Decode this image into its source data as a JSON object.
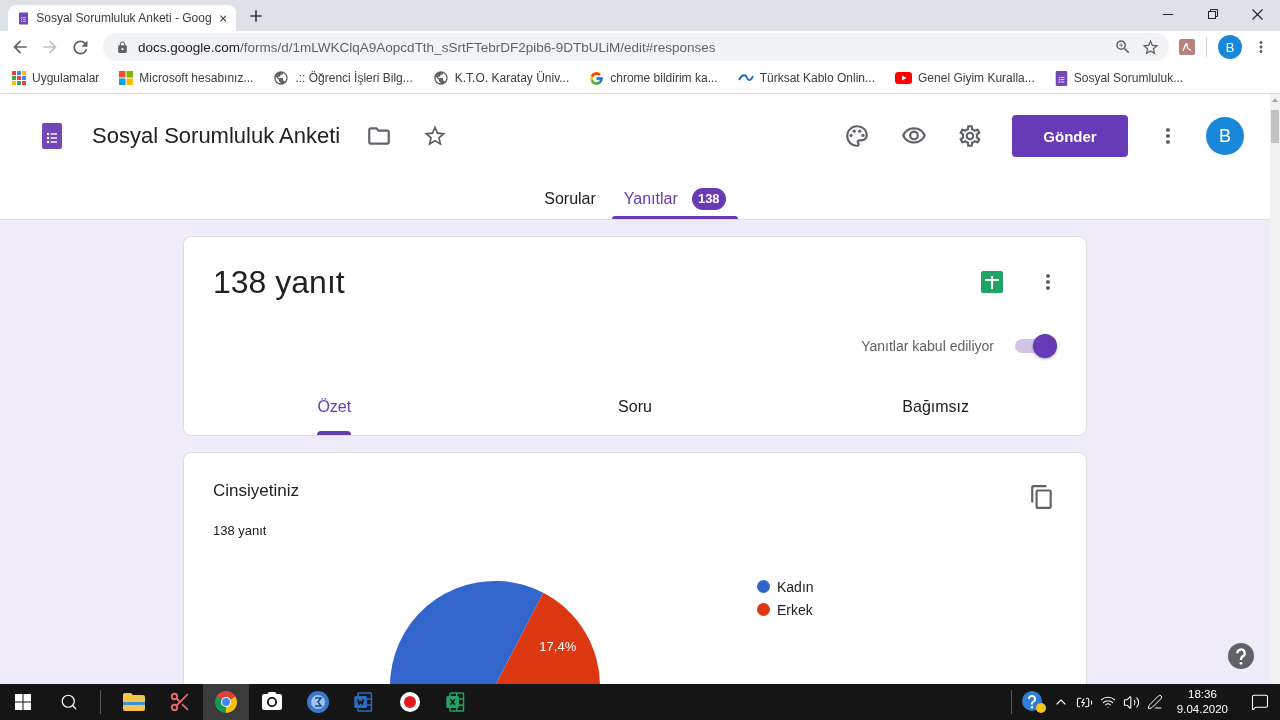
{
  "browser": {
    "tabs": [
      {
        "title": "Sosyal Sorumluluk Anketi - Goog",
        "selected": true
      }
    ],
    "address": {
      "host": "docs.google.com",
      "path": "/forms/d/1mLWKClqA9AopcdTth_sSrtFTebrDF2pib6-9DTbULiM/edit#responses"
    },
    "profile_initial": "B",
    "bookmarks": [
      {
        "kind": "apps",
        "label": "Uygulamalar"
      },
      {
        "kind": "microsoft",
        "label": "Microsoft hesabınız..."
      },
      {
        "kind": "globe",
        "label": ".:: Öğrenci İşleri Bilg..."
      },
      {
        "kind": "globe",
        "label": "K.T.O. Karatay Üniv..."
      },
      {
        "kind": "google",
        "label": "chrome bildirim ka..."
      },
      {
        "kind": "kablo",
        "label": "Türksat Kablo Onlin..."
      },
      {
        "kind": "youtube",
        "label": "Genel Giyim Kuralla..."
      },
      {
        "kind": "forms",
        "label": "Sosyal Sorumluluk..."
      }
    ]
  },
  "form": {
    "title": "Sosyal Sorumluluk Anketi",
    "send_button": "Gönder",
    "avatar_initial": "B",
    "tabs": [
      {
        "label": "Sorular",
        "selected": false
      },
      {
        "label": "Yanıtlar",
        "selected": true,
        "count": "138"
      }
    ]
  },
  "summary_card": {
    "heading": "138 yanıt",
    "accepting_label": "Yanıtlar kabul ediliyor",
    "accepting": true,
    "tabs": [
      {
        "label": "Özet",
        "selected": true
      },
      {
        "label": "Soru",
        "selected": false
      },
      {
        "label": "Bağımsız",
        "selected": false
      }
    ]
  },
  "question_card": {
    "title": "Cinsiyetiniz",
    "response_count": "138 yanıt",
    "chart_data": {
      "type": "pie",
      "categories": [
        "Kadın",
        "Erkek"
      ],
      "values": [
        82.6,
        17.4
      ],
      "colors": [
        "#3366cc",
        "#dc3912"
      ],
      "value_labels": [
        null,
        "17,4%"
      ],
      "legend": "right"
    }
  },
  "taskbar": {
    "apps": [
      {
        "kind": "explorer",
        "selected": false
      },
      {
        "kind": "snipping",
        "selected": false
      },
      {
        "kind": "chrome",
        "selected": true
      },
      {
        "kind": "camera",
        "selected": false
      },
      {
        "kind": "sigma",
        "selected": false
      },
      {
        "kind": "word",
        "selected": false
      },
      {
        "kind": "record",
        "selected": false
      },
      {
        "kind": "excel",
        "selected": false
      }
    ],
    "time": "18:36",
    "date": "9.04.2020"
  }
}
